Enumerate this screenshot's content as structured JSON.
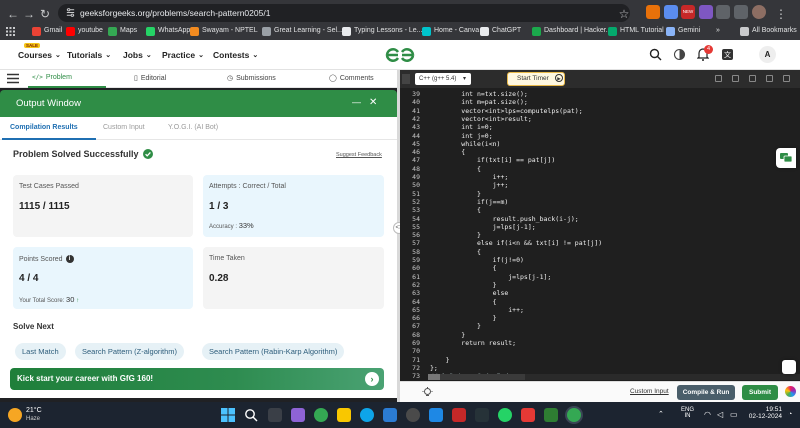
{
  "browser": {
    "url": "geeksforgeeks.org/problems/search-pattern0205/1",
    "bookmarks": [
      {
        "label": "Gmail",
        "color": "#ea4335"
      },
      {
        "label": "youtube",
        "color": "#ff0000"
      },
      {
        "label": "Maps",
        "color": "#34a853"
      },
      {
        "label": "WhatsApp",
        "color": "#25d366"
      },
      {
        "label": "Swayam - NPTEL",
        "color": "#f28b20"
      },
      {
        "label": "Great Learning - Sel...",
        "color": "#9aa0a6"
      },
      {
        "label": "Typing Lessons - Le...",
        "color": "#e8eaed"
      },
      {
        "label": "Home - Canva",
        "color": "#00c4cc"
      },
      {
        "label": "ChatGPT",
        "color": "#e8eaed"
      },
      {
        "label": "Dashboard | Hacker...",
        "color": "#1ba94c"
      },
      {
        "label": "HTML Tutorial",
        "color": "#04aa6d"
      },
      {
        "label": "Gemini",
        "color": "#8ab4f8"
      }
    ],
    "all_bookmarks": "All Bookmarks",
    "overflow": "»",
    "new_badge": "NEW"
  },
  "site": {
    "sale_badge": "SALE",
    "menu": [
      "Courses",
      "Tutorials",
      "Jobs",
      "Practice",
      "Contests"
    ],
    "notif_count": "4",
    "avatar": "A"
  },
  "tabs": {
    "problem": "Problem",
    "editorial": "Editorial",
    "submissions": "Submissions",
    "comments": "Comments"
  },
  "output": {
    "title": "Output Window",
    "minimize": "—",
    "close": "✕",
    "subtabs": [
      "Compilation Results",
      "Custom Input",
      "Y.O.G.I. (AI Bot)"
    ],
    "status": "Problem Solved Successfully",
    "feedback": "Suggest Feedback",
    "test_cases": {
      "label": "Test Cases Passed",
      "value": "1115 / 1115"
    },
    "attempts": {
      "label": "Attempts : Correct / Total",
      "value": "1 / 3",
      "accuracy_label": "Accuracy :",
      "accuracy": "33%"
    },
    "points": {
      "label": "Points Scored",
      "value": "4 / 4",
      "total_label": "Your Total Score:",
      "total": "30"
    },
    "time": {
      "label": "Time Taken",
      "value": "0.28"
    },
    "solve_next": "Solve Next",
    "suggestions": [
      "Last Match",
      "Search Pattern (Z-algorithm)",
      "Search Pattern (Rabin-Karp Algorithm)"
    ],
    "career": "Kick start your career with GfG 160!"
  },
  "editor": {
    "language": "C++ (g++ 5.4)",
    "timer": "Start Timer",
    "lines": [
      {
        "n": "39",
        "t": "        int n=txt.size();"
      },
      {
        "n": "40",
        "t": "        int m=pat.size();"
      },
      {
        "n": "41",
        "t": "        vector<int>lps=computelps(pat);"
      },
      {
        "n": "42",
        "t": "        vector<int>result;"
      },
      {
        "n": "43",
        "t": "        int i=0;"
      },
      {
        "n": "44",
        "t": "        int j=0;"
      },
      {
        "n": "45",
        "t": "        while(i<n)"
      },
      {
        "n": "46",
        "t": "        {"
      },
      {
        "n": "47",
        "t": "            if(txt[i] == pat[j])"
      },
      {
        "n": "48",
        "t": "            {"
      },
      {
        "n": "49",
        "t": "                i++;"
      },
      {
        "n": "50",
        "t": "                j++;"
      },
      {
        "n": "51",
        "t": "            }"
      },
      {
        "n": "52",
        "t": "            if(j==m)"
      },
      {
        "n": "53",
        "t": "            {"
      },
      {
        "n": "54",
        "t": "                result.push_back(i-j);"
      },
      {
        "n": "55",
        "t": "                j=lps[j-1];"
      },
      {
        "n": "56",
        "t": "            }"
      },
      {
        "n": "57",
        "t": "            else if(i<n && txt[i] != pat[j])"
      },
      {
        "n": "58",
        "t": "            {"
      },
      {
        "n": "59",
        "t": "                if(j!=0)"
      },
      {
        "n": "60",
        "t": "                {"
      },
      {
        "n": "61",
        "t": "                    j=lps[j-1];"
      },
      {
        "n": "62",
        "t": "                }"
      },
      {
        "n": "63",
        "t": "                else"
      },
      {
        "n": "64",
        "t": "                {"
      },
      {
        "n": "65",
        "t": "                    i++;"
      },
      {
        "n": "66",
        "t": "                }"
      },
      {
        "n": "67",
        "t": "            }"
      },
      {
        "n": "68",
        "t": "        }"
      },
      {
        "n": "69",
        "t": "        return result;"
      },
      {
        "n": "70",
        "t": ""
      },
      {
        "n": "71",
        "t": "    }"
      },
      {
        "n": "72",
        "t": "};"
      },
      {
        "n": "73",
        "t": "// } Driver Code Ends"
      }
    ],
    "custom_input": "Custom Input",
    "compile": "Compile & Run",
    "submit": "Submit"
  },
  "taskbar": {
    "weather_temp": "21°C",
    "weather_desc": "Haze",
    "lang": "ENG",
    "region": "IN",
    "time": "19:51",
    "date": "02-12-2024"
  }
}
